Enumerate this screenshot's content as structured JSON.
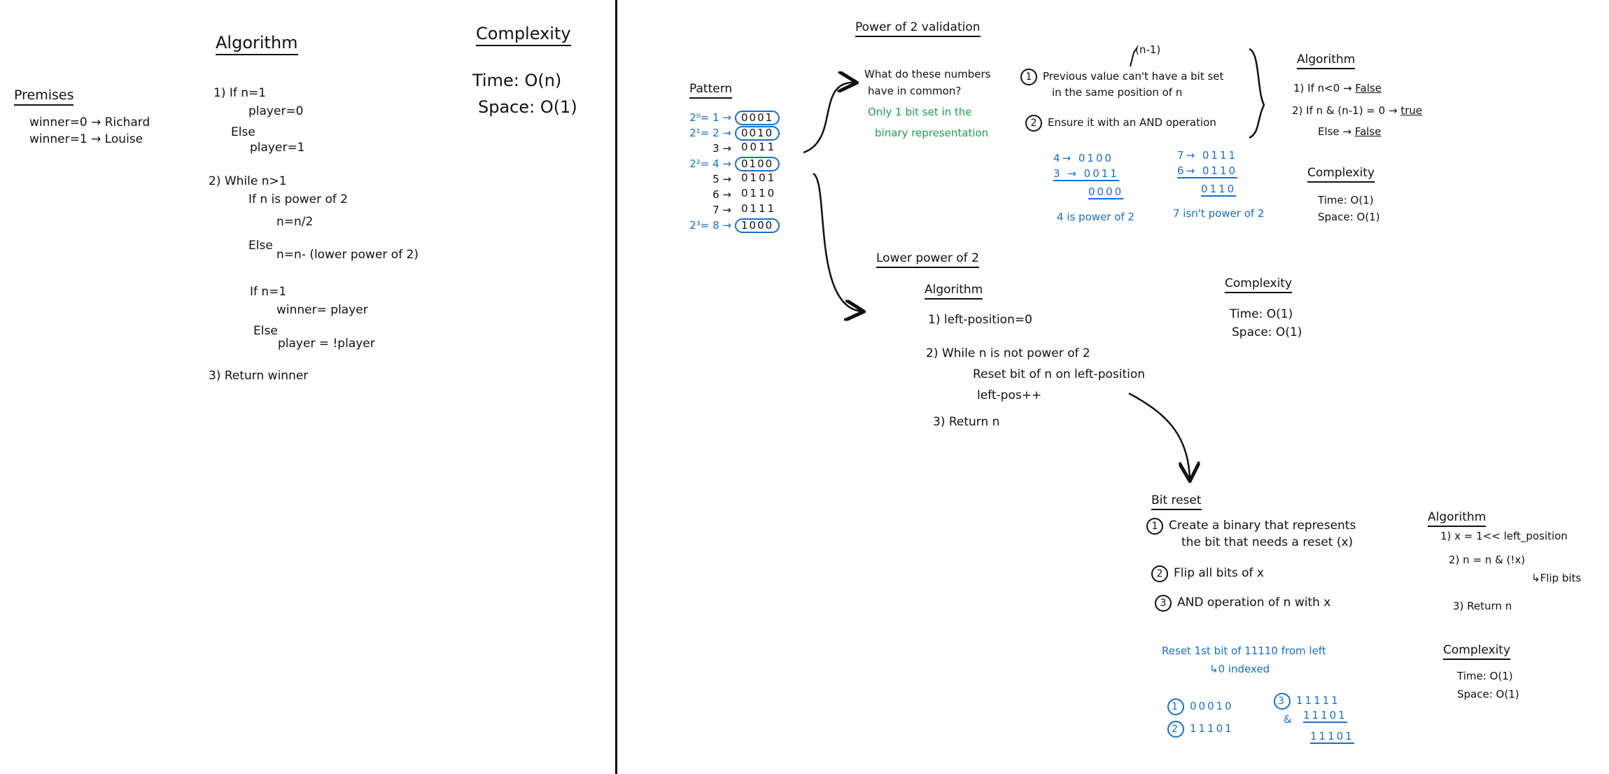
{
  "left": {
    "premises": {
      "title": "Premises",
      "line1": "winner=0 → Richard",
      "line2": "winner=1 → Louise"
    },
    "algorithm": {
      "title": "Algorithm",
      "s1": "1) If n=1",
      "s1a": "player=0",
      "s1b": "Else",
      "s1c": "player=1",
      "s2": "2) While n>1",
      "s2a": "If n is power of 2",
      "s2b": "n=n/2",
      "s2c": "Else",
      "s2d": "n=n- (lower power of 2)",
      "s2e": "If n=1",
      "s2f": "winner= player",
      "s2g": "Else",
      "s2h": "player = !player",
      "s3": "3) Return winner"
    },
    "complexity": {
      "title": "Complexity",
      "time": "Time: O(n)",
      "space": "Space: O(1)"
    }
  },
  "pattern": {
    "title": "Pattern",
    "rows": [
      {
        "label": "2⁰= 1 →",
        "bits": "0001",
        "circled": true
      },
      {
        "label": "2¹= 2 →",
        "bits": "0010",
        "circled": true
      },
      {
        "label": "3 →",
        "bits": "0011",
        "circled": false
      },
      {
        "label": "2²= 4 →",
        "bits": "0100",
        "circled": true
      },
      {
        "label": "5 →",
        "bits": "0101",
        "circled": false
      },
      {
        "label": "6 →",
        "bits": "0110",
        "circled": false
      },
      {
        "label": "7 →",
        "bits": "0111",
        "circled": false
      },
      {
        "label": "2³= 8 →",
        "bits": "1000",
        "circled": true
      }
    ]
  },
  "power_validation": {
    "title": "Power of 2 validation",
    "question": "What do these numbers",
    "question2": "have in common?",
    "answer1": "Only 1 bit set in the",
    "answer2": "binary representation",
    "n_minus_1": "(n-1)",
    "step1a": "Previous value can't have a bit set",
    "step1b": "in the same position of n",
    "step2": "Ensure it with an AND operation",
    "ex1": {
      "l1": "4→ 0100",
      "l2": "3 → 0011",
      "r": "0000",
      "note": "4 is power of 2"
    },
    "ex2": {
      "l1": "7→ 0111",
      "l2": "6→ 0110",
      "r": "0110",
      "note": "7 isn't power of 2"
    },
    "algorithm": {
      "title": "Algorithm",
      "s1": "1) If n<0 →",
      "s1r": "False",
      "s2": "2) If n & (n-1) = 0 →",
      "s2r": "true",
      "s2e": "Else →",
      "s2er": "False"
    },
    "complexity": {
      "title": "Complexity",
      "time": "Time: O(1)",
      "space": "Space: O(1)"
    }
  },
  "lower_power": {
    "title": "Lower power of 2",
    "algorithm_title": "Algorithm",
    "s1": "1) left-position=0",
    "s2": "2) While n is not power of 2",
    "s2a": "Reset bit of n on left-position",
    "s2b": "left-pos++",
    "s3": "3) Return n",
    "complexity": {
      "title": "Complexity",
      "time": "Time: O(1)",
      "space": "Space: O(1)"
    }
  },
  "bit_reset": {
    "title": "Bit reset",
    "step1a": "Create a binary that represents",
    "step1b": "the bit that needs a reset (x)",
    "step2": "Flip all bits of x",
    "step3": "AND operation of n with x",
    "example_title": "Reset 1st bit of 11110 from left",
    "example_sub": "↳0 indexed",
    "ex_a": "00010",
    "ex_b": "11101",
    "ex_c1": "11111",
    "ex_c2": "11101",
    "ex_c3": "11101",
    "amp": "&",
    "algorithm": {
      "title": "Algorithm",
      "s1": "1) x = 1<< left_position",
      "s2": "2) n = n & (!x)",
      "s2a": "↳Flip bits",
      "s3": "3) Return n"
    },
    "complexity": {
      "title": "Complexity",
      "time": "Time: O(1)",
      "space": "Space: O(1)"
    }
  },
  "colors": {
    "ink": "#111111",
    "blue": "#1a6fc4",
    "green": "#1f9e4a"
  }
}
